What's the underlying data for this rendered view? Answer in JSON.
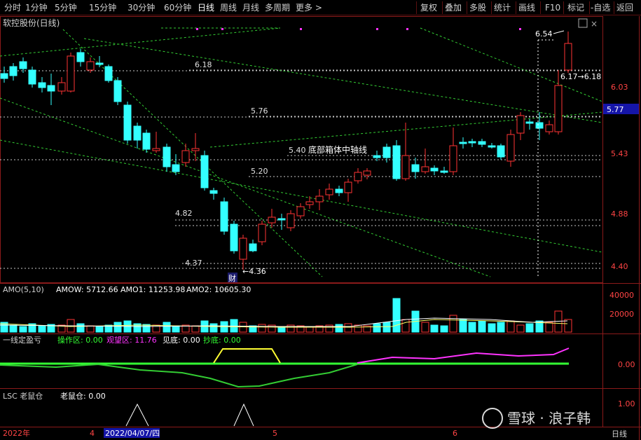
{
  "toolbar": {
    "periods": [
      "分时",
      "1分钟",
      "5分钟",
      "15分钟",
      "30分钟",
      "60分钟",
      "日线",
      "周线",
      "月线",
      "多周期",
      "更多 >"
    ],
    "active_period": "日线",
    "tools": [
      "复权",
      "叠加",
      "多股",
      "统计",
      "画线",
      "F10",
      "标记",
      "-自选",
      "返回"
    ]
  },
  "main": {
    "title": "软控股份(日线)",
    "current_price": "5.77",
    "price_axis": [
      "6.03",
      "5.43",
      "4.88",
      "4.40"
    ],
    "level_labels": {
      "l618": "6.18",
      "l576": "5.76",
      "l540": "5.40",
      "l520": "5.20",
      "l482": "4.82",
      "l437": "4.37"
    },
    "box_axis_label": "底部箱体中轴线",
    "high_label": "6.54",
    "low_label": "4.36",
    "range_label": "6.17→6.18",
    "event_label": "财"
  },
  "amo": {
    "name": "AMO(5,10)",
    "amow": "AMOW: 5712.66",
    "amo1": "AMO1: 11253.98",
    "amo2": "AMO2: 10605.30",
    "axis": [
      "40000",
      "20000"
    ],
    "colors": {
      "label": "#ffffff"
    }
  },
  "ind1": {
    "name": "一线定盈亏",
    "op": "操作区: 0.00",
    "watch": "观望区: 11.76",
    "bottom": "见底: 0.00",
    "buy": "抄底: 0.00",
    "axis": "0.00",
    "colors": {
      "op": "#33ff33",
      "watch": "#ff33ff",
      "bottom": "#ffffff",
      "buy": "#33ff33"
    }
  },
  "ind2": {
    "name": "LSC 老鼠仓",
    "value": "老鼠仓: 0.00",
    "axis": "1.00",
    "period_label": "日线"
  },
  "time_axis": {
    "labels": [
      "2022年",
      "4",
      "2022/04/07/四",
      "5",
      "6"
    ]
  },
  "watermark": {
    "text": "雪球 · 浪子韩"
  },
  "colors": {
    "up": "#ff3333",
    "down": "#33ffff",
    "grid": "#8b1a1a",
    "level": "#c8c8c8",
    "trend": "#33cc33",
    "frame": "#8b1a1a",
    "current_price_bg": "#1515a8"
  }
}
